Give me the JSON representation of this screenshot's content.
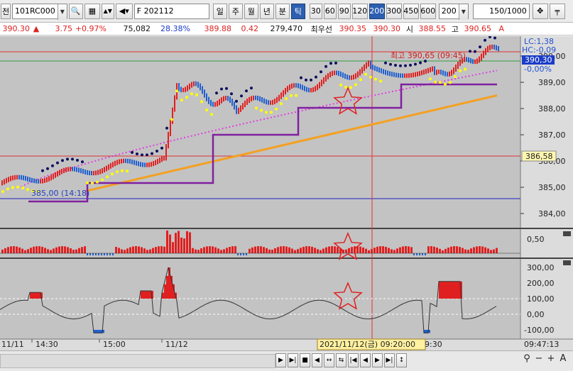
{
  "toolbar": {
    "market_btn": "전",
    "code": "101RC000",
    "name": "F 202112",
    "periods": [
      "일",
      "주",
      "월",
      "년",
      "분",
      "틱"
    ],
    "selected_period": "틱",
    "tick_units": [
      "30",
      "60",
      "90",
      "120",
      "200",
      "300",
      "450",
      "600"
    ],
    "selected_unit": "200",
    "unit_combo": "200",
    "count": "150",
    "total": "/1000"
  },
  "quote": {
    "price": "390.30",
    "change": "3.75",
    "change_pct": "+0.97%",
    "volume": "75,082",
    "vol_ratio": "28.38%",
    "bid_price": "389.88",
    "bid_change": "0.42",
    "open_interest": "279,470",
    "best_label": "최우선",
    "best_ask": "390.35",
    "best_bid": "390.30",
    "open_label": "시",
    "open": "388.55",
    "high_label": "고",
    "high": "390.65",
    "high_icon_label": "A"
  },
  "chart": {
    "y_ticks": [
      "390,00",
      "389,00",
      "388,00",
      "387,00",
      "386,00",
      "385,00",
      "384,00"
    ],
    "right_labels": {
      "lc": "LC:1,38",
      "hc": "HC:-0,09",
      "current": "390,30",
      "pct": "-0,00%",
      "level": "386,58"
    },
    "high_annotation": "최고 390,65 (09:45)",
    "low_annotation": "385,00 (14:18)",
    "vol_ticks": [
      "0,50"
    ],
    "osc_ticks": [
      "300,00",
      "200,00",
      "100,00",
      "0,00",
      "-100,00"
    ],
    "x_labels": [
      "11/11",
      "14:30",
      "15:00",
      "11/12",
      "9:30"
    ],
    "cursor_date": "2021/11/12(금) 09:20:00",
    "time_now": "09:47:13"
  },
  "colors": {
    "up": "#e02020",
    "down": "#2060d0",
    "cyan": "#30d0f0",
    "yellow": "#ffff00",
    "orange": "#f4a020",
    "magenta": "#e040e0",
    "purple": "#8020a0",
    "navy": "#101060"
  }
}
